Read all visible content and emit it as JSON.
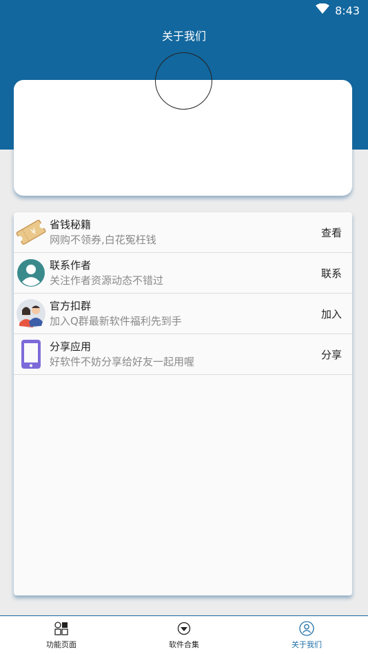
{
  "status_bar": {
    "time": "8:43"
  },
  "header": {
    "title": "关于我们"
  },
  "list": [
    {
      "title": "省钱秘籍",
      "subtitle": "网购不领券,白花冤枉钱",
      "action": "查看",
      "icon": "coupon-icon"
    },
    {
      "title": "联系作者",
      "subtitle": "关注作者资源动态不错过",
      "action": "联系",
      "icon": "person-icon"
    },
    {
      "title": "官方扣群",
      "subtitle": "加入Q群最新软件福利先到手",
      "action": "加入",
      "icon": "group-icon"
    },
    {
      "title": "分享应用",
      "subtitle": "好软件不妨分享给好友一起用喔",
      "action": "分享",
      "icon": "phone-icon"
    }
  ],
  "nav": [
    {
      "label": "功能页面",
      "icon": "grid-icon"
    },
    {
      "label": "软件合集",
      "icon": "collection-icon"
    },
    {
      "label": "关于我们",
      "icon": "profile-icon",
      "active": true
    }
  ],
  "colors": {
    "primary": "#12679e",
    "active_nav": "#1f6fa8"
  }
}
